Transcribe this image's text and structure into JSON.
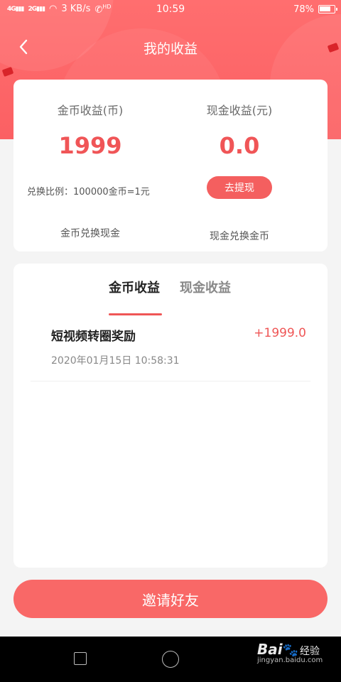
{
  "status_bar": {
    "network_a": "4G",
    "network_b": "2G",
    "speed": "3 KB/s",
    "call_badge": "HD",
    "time": "10:59",
    "battery": "78%",
    "battery_level": 0.78
  },
  "header": {
    "title": "我的收益"
  },
  "summary": {
    "coin_label": "金币收益(币)",
    "coin_value": "1999",
    "cash_label": "现金收益(元)",
    "cash_value": "0.0",
    "ratio_text": "兑换比例：100000金币=1元",
    "withdraw_button": "去提现",
    "coin_to_cash": "金币兑换现金",
    "cash_to_coin": "现金兑换金币"
  },
  "tabs": [
    {
      "label": "金币收益",
      "active": true
    },
    {
      "label": "现金收益",
      "active": false
    }
  ],
  "records": [
    {
      "title": "短视频转圈奖励",
      "amount": "+1999.0",
      "time": "2020年01月15日 10:58:31"
    }
  ],
  "invite_button": "邀请好友",
  "watermark": {
    "brand": "Bai",
    "brand_sub": "经验",
    "url": "jingyan.baidu.com"
  },
  "colors": {
    "accent": "#f05557",
    "header": "#fb6063",
    "button": "#f96867"
  }
}
